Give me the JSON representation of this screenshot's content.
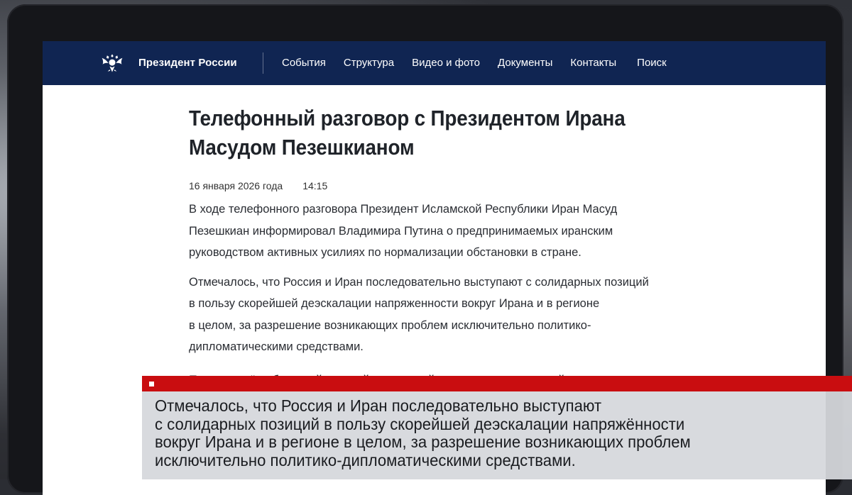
{
  "site": {
    "brand": "Президент России",
    "nav": [
      "События",
      "Структура",
      "Видео и фото",
      "Документы",
      "Контакты"
    ],
    "search_label": "Поиск",
    "nav_color": "#102552",
    "emblem_icon": "double-headed-eagle-icon"
  },
  "article": {
    "title_line1": "Телефонный разговор с Президентом Ирана",
    "title_line2": "Масудом Пезешкианом",
    "date": "16 января 2026 года",
    "time": "14:15",
    "paragraph1": [
      "В ходе телефонного разговора Президент Исламской Республики Иран Масуд",
      "Пезешкиан информировал Владимира Путина о предпринимаемых иранским",
      "руководством активных усилиях по нормализации обстановки в стране."
    ],
    "paragraph2": [
      "Отмечалось, что Россия и Иран последовательно выступают с солидарных позиций",
      "в пользу скорейшей деэскалации напряженности вокруг Ирана и в регионе",
      "в целом, за разрешение возникающих проблем исключительно политико-",
      "дипломатическими средствами."
    ],
    "paragraph3_partial": "Подтверждён обоюдный настрой на дальнейшее укрепление российско-иранского"
  },
  "caption": {
    "bar_color": "#c90d10",
    "lines": [
      "Отмечалось, что Россия и Иран последовательно выступают",
      "с солидарных позиций в пользу скорейшей деэскалации напряжённости",
      "вокруг Ирана и в регионе в целом, за разрешение возникающих проблем",
      "исключительно политико-дипломатическими средствами."
    ]
  }
}
